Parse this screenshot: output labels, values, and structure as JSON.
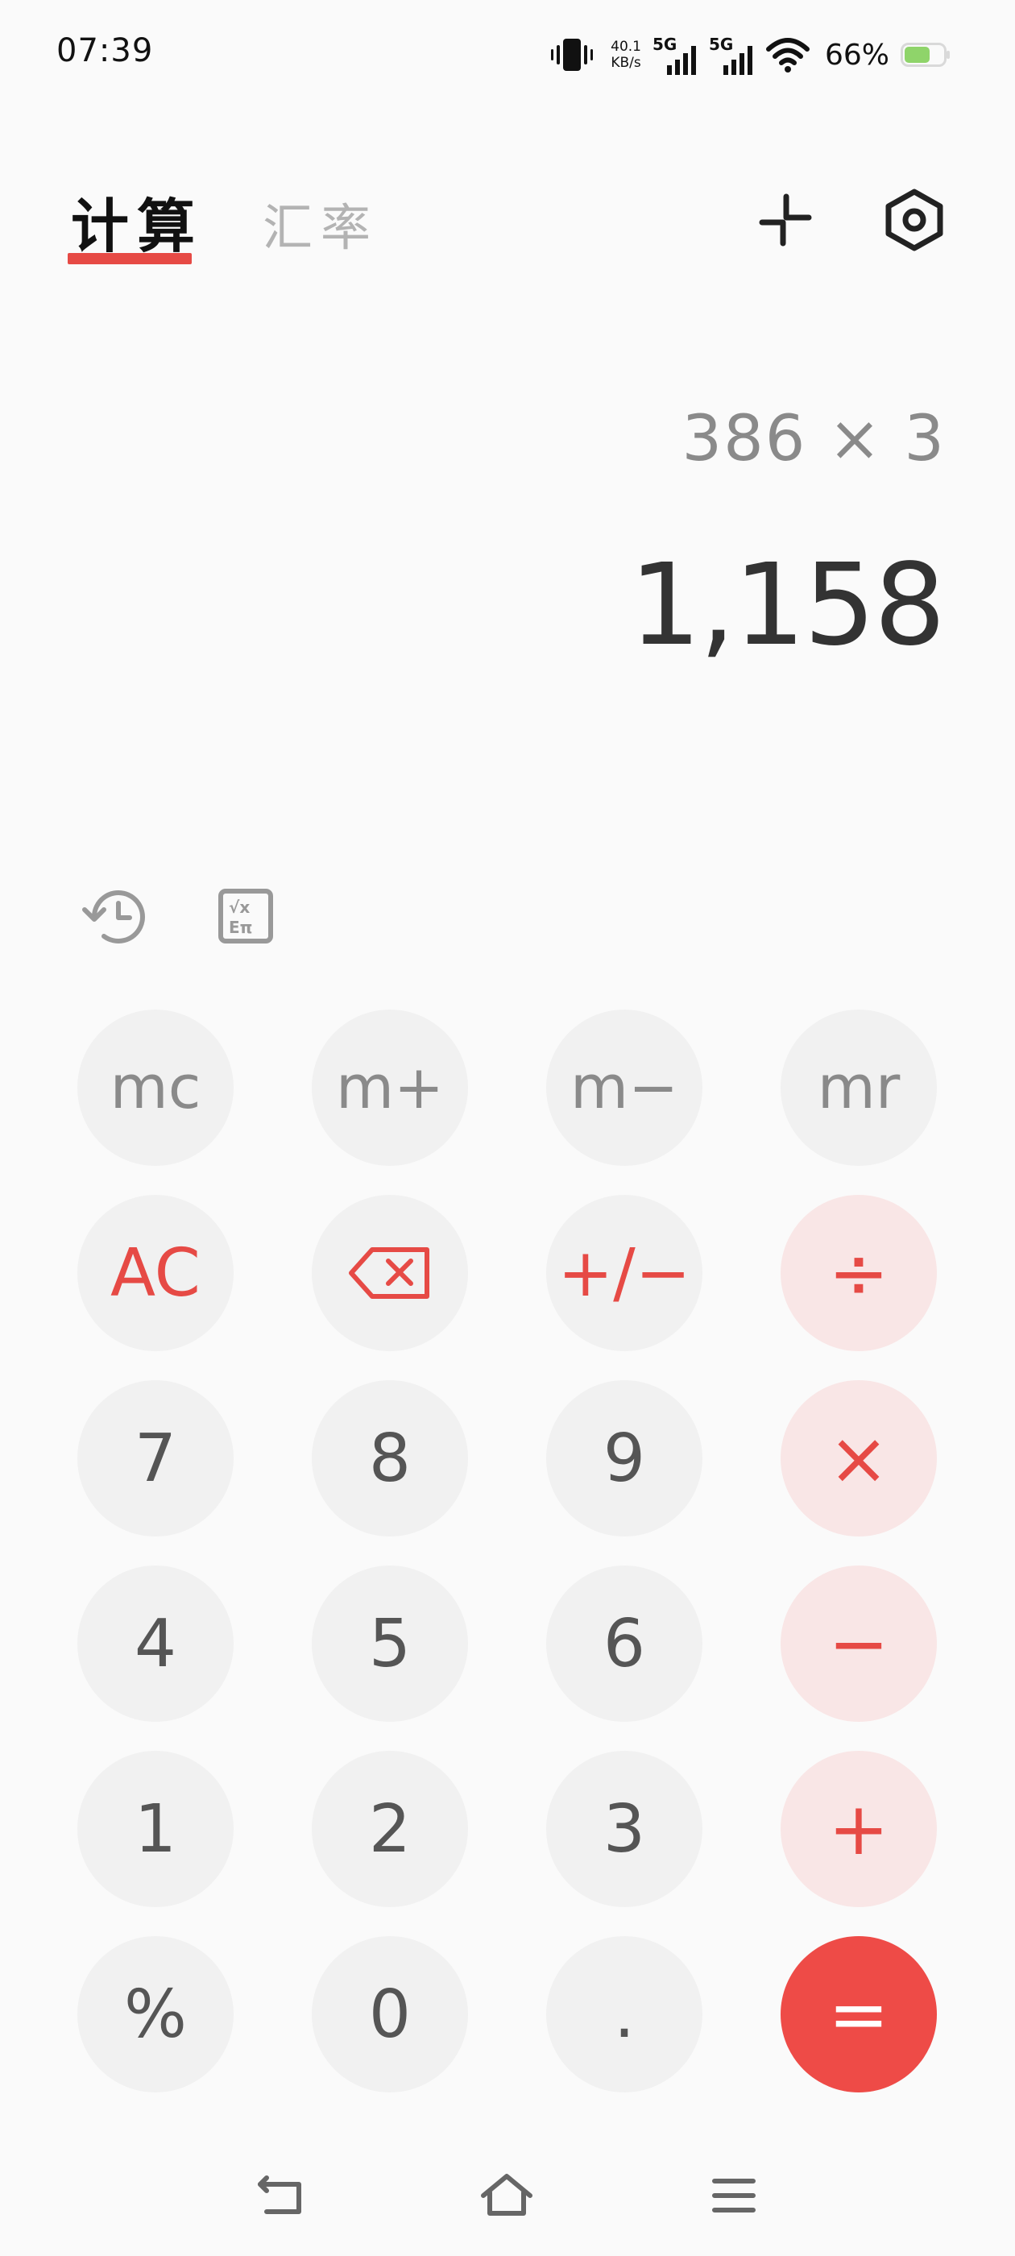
{
  "status_bar": {
    "time": "07:39",
    "net_speed_value": "40.1",
    "net_speed_unit": "KB/s",
    "sim1_label": "5G",
    "sim2_label": "5G",
    "battery_percent": "66%",
    "battery_level": 0.66,
    "battery_color": "#8fd46a"
  },
  "header": {
    "tab_calc": "计算",
    "tab_rate": "汇率",
    "accent_color": "#e64a45",
    "icons": [
      "collapse-icon",
      "settings-hexagon-icon"
    ]
  },
  "display": {
    "expression": "386 × 3",
    "result": "1,158"
  },
  "tools": {
    "icons": [
      "history-icon",
      "scientific-mode-icon"
    ]
  },
  "keypad": {
    "rows": [
      [
        "mc",
        "m+",
        "m−",
        "mr"
      ],
      [
        "AC",
        "",
        "+/−",
        "÷"
      ],
      [
        "7",
        "8",
        "9",
        "×"
      ],
      [
        "4",
        "5",
        "6",
        "−"
      ],
      [
        "1",
        "2",
        "3",
        "+"
      ],
      [
        "%",
        "0",
        ".",
        "="
      ]
    ],
    "colors": {
      "key_bg": "#f1f1f1",
      "operator_bg": "#f9e6e6",
      "operator_fg": "#e64a45",
      "equals_bg": "#ee4b47",
      "equals_fg": "#ffffff"
    }
  },
  "nav_bar": {
    "icons": [
      "back-icon",
      "home-icon",
      "menu-icon"
    ]
  }
}
